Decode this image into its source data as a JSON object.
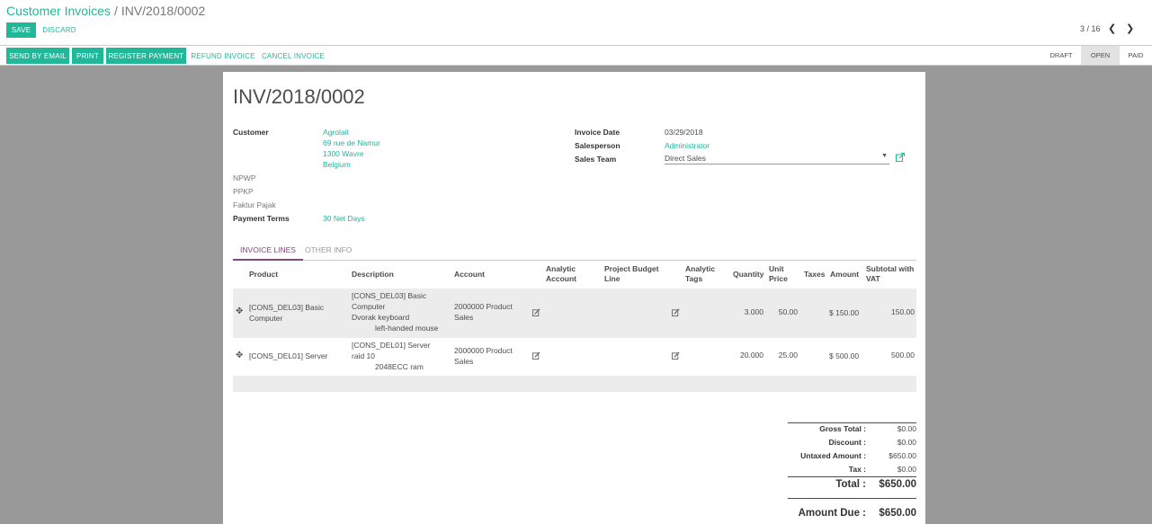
{
  "breadcrumb": {
    "parent": "Customer Invoices",
    "separator": "/",
    "current": "INV/2018/0002"
  },
  "actions": {
    "save": "SAVE",
    "discard": "DISCARD"
  },
  "pager": {
    "value": "3 / 16"
  },
  "buttons": {
    "send_email": "SEND BY EMAIL",
    "print": "PRINT",
    "register_payment": "REGISTER PAYMENT",
    "refund": "REFUND INVOICE",
    "cancel": "CANCEL INVOICE"
  },
  "stages": [
    {
      "label": "DRAFT"
    },
    {
      "label": "OPEN"
    },
    {
      "label": "PAID"
    }
  ],
  "invoice": {
    "title": "INV/2018/0002",
    "customer_label": "Customer",
    "customer_lines": [
      "Agrolait",
      "69 rue de Namur",
      "1300 Wavre",
      "Belgium"
    ],
    "npwp_label": "NPWP",
    "ppkp_label": "PPKP",
    "faktur_label": "Faktur Pajak",
    "payment_terms_label": "Payment Terms",
    "payment_terms": "30 Net Days",
    "invoice_date_label": "Invoice Date",
    "invoice_date": "03/29/2018",
    "salesperson_label": "Salesperson",
    "salesperson": "Administrator",
    "sales_team_label": "Sales Team",
    "sales_team": "Direct Sales"
  },
  "tabs": {
    "lines": "INVOICE LINES",
    "other": "OTHER INFO"
  },
  "columns": {
    "product": "Product",
    "description": "Description",
    "account": "Account",
    "analytic_1": "Analytic",
    "analytic_2": "Account",
    "budget_1": "Project Budget",
    "budget_2": "Line",
    "tags_1": "Analytic",
    "tags_2": "Tags",
    "quantity": "Quantity",
    "unit_1": "Unit",
    "unit_2": "Price",
    "taxes": "Taxes",
    "amount": "Amount",
    "subtotal_1": "Subtotal with",
    "subtotal_2": "VAT"
  },
  "lines": [
    {
      "product_1": "[CONS_DEL03] Basic",
      "product_2": "Computer",
      "desc_1": "[CONS_DEL03] Basic",
      "desc_2": "Computer",
      "desc_3": "Dvorak keyboard",
      "desc_4": "left-handed mouse",
      "account_1": "2000000 Product",
      "account_2": "Sales",
      "quantity": "3.000",
      "unit_price": "50.00",
      "amount": "$ 150.00",
      "subtotal": "150.00"
    },
    {
      "product_1": "[CONS_DEL01] Server",
      "product_2": "",
      "desc_1": "[CONS_DEL01] Server",
      "desc_2": "raid 10",
      "desc_3": "2048ECC ram",
      "desc_4": "",
      "account_1": "2000000 Product",
      "account_2": "Sales",
      "quantity": "20.000",
      "unit_price": "25.00",
      "amount": "$ 500.00",
      "subtotal": "500.00"
    }
  ],
  "totals": {
    "gross_label": "Gross Total :",
    "gross": "$0.00",
    "discount_label": "Discount :",
    "discount": "$0.00",
    "untaxed_label": "Untaxed Amount :",
    "untaxed": "$650.00",
    "tax_label": "Tax :",
    "tax": "$0.00",
    "total_label": "Total :",
    "total": "$650.00",
    "due_label": "Amount Due :",
    "due": "$650.00"
  },
  "colors": {
    "accent": "#21b799",
    "tab_active": "#7c4a79",
    "backdrop": "#999999"
  }
}
